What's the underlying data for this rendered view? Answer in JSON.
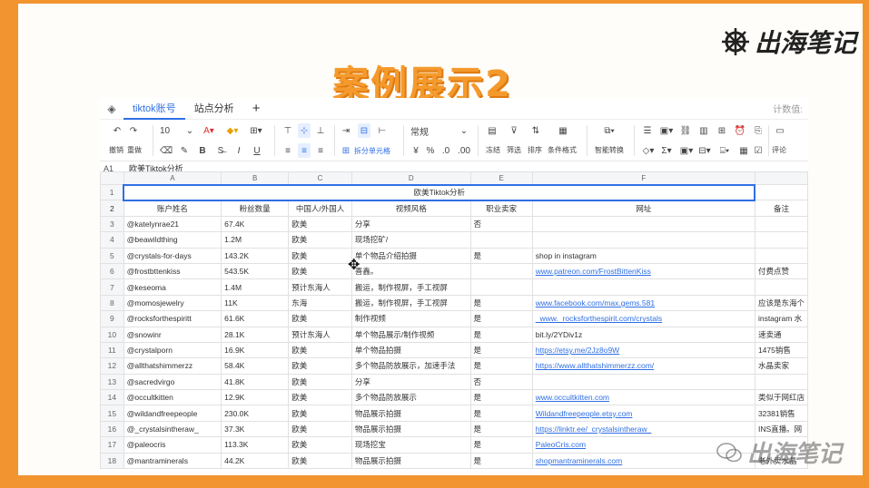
{
  "slide": {
    "title": "案例展示2",
    "brand": "出海笔记",
    "watermark": "出海笔记"
  },
  "app": {
    "tabs": [
      "tiktok账号",
      "站点分析"
    ],
    "tab_right": "计数值:",
    "toolbar": {
      "undo": "撤销",
      "redo": "重做",
      "font_size": "10",
      "merge_cells": "拆分单元格",
      "number_format": "常规",
      "freeze": "冻结",
      "filter": "筛选",
      "sort": "排序",
      "cond_format": "条件格式",
      "smart_convert": "智能转换",
      "comment": "评论"
    },
    "formula": {
      "ref": "A1",
      "value": "欧美Tiktok分析"
    }
  },
  "sheet": {
    "columns": [
      "A",
      "B",
      "C",
      "D",
      "E",
      "F",
      ""
    ],
    "merged_title": "欧美Tiktok分析",
    "headers": [
      "账户姓名",
      "粉丝数量",
      "中国人/外国人",
      "视频风格",
      "职业卖家",
      "网址",
      "备注"
    ],
    "rows": [
      [
        "@katelynrae21",
        "67.4K",
        "欧美",
        "分享",
        "否",
        "",
        ""
      ],
      [
        "@beawildthing",
        "1.2M",
        "欧美",
        "现场挖矿/",
        "",
        "",
        ""
      ],
      [
        "@crystals-for-days",
        "143.2K",
        "欧美",
        "单个物品介绍拍摄",
        "是",
        "shop in instagram",
        ""
      ],
      [
        "@frostbttenkiss",
        "543.5K",
        "欧美",
        "喜鑫。",
        "",
        "www.patreon.com/FrostBittenKiss",
        "付费点赞"
      ],
      [
        "@keseoma",
        "1.4M",
        "预计东海人",
        "搬运，制作视屏，手工视屏",
        "",
        "",
        ""
      ],
      [
        "@momosjewelry",
        "11K",
        "东海",
        "搬运，制作视屏，手工视屏",
        "是",
        "www.facebook.com/max.gems.581",
        "应该是东海个"
      ],
      [
        "@rocksforthespiritt",
        "61.6K",
        "欧美",
        "制作视频",
        "是",
        "_www._rocksforthespirit.com/crystals",
        "instagram 水"
      ],
      [
        "@snowinr",
        "28.1K",
        "预计东海人",
        "单个物品展示/制作视频",
        "是",
        "bit.ly/2YDiv1z",
        "速卖通"
      ],
      [
        "@crystalporn",
        "16.9K",
        "欧美",
        "单个物品拍摄",
        "是",
        "https://etsy.me/2Jz8o9W",
        "1475销售"
      ],
      [
        "@allthatshimmerzz",
        "58.4K",
        "欧美",
        "多个物品防放展示，加速手法",
        "是",
        "https://www.allthatshimmerzz.com/",
        "水晶卖家"
      ],
      [
        "@sacredvirgo",
        "41.8K",
        "欧美",
        "分享",
        "否",
        "",
        ""
      ],
      [
        "@occultkitten",
        "12.9K",
        "欧美",
        "多个物品防放展示",
        "是",
        "www.occultkitten.com",
        "类似于网红店"
      ],
      [
        "@wildandfreepeople",
        "230.0K",
        "欧美",
        "物品展示拍摄",
        "是",
        "Wildandfreepeople.etsy.com",
        "32381销售"
      ],
      [
        "@_crystalsintheraw_",
        "37.3K",
        "欧美",
        "物品展示拍摄",
        "是",
        "https://linktr.ee/_crystalsintheraw_",
        "INS直播。网"
      ],
      [
        "@paleocris",
        "113.3K",
        "欧美",
        "现场挖宝",
        "是",
        "PaleoCris.com",
        ""
      ],
      [
        "@mantraminerals",
        "44.2K",
        "欧美",
        "物品展示拍摄",
        "是",
        "shopmantraminerals.com",
        "老外卖水晶"
      ]
    ]
  },
  "colors": {
    "accent": "#2f6fe4",
    "slide_border": "#f29430",
    "title": "#f49a2c"
  }
}
